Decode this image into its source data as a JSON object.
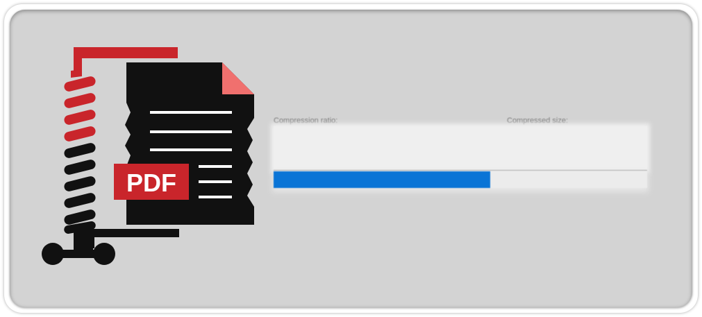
{
  "logo": {
    "text": "PDF",
    "icon": "pdf-compress-icon",
    "colors": {
      "red": "#c9252b",
      "black": "#111111",
      "corner": "#f0706e",
      "white": "#ffffff"
    }
  },
  "compression": {
    "ratio_label": "Compression ratio:",
    "size_label": "Compressed size:",
    "progress_fraction": 0.58,
    "progress_color": "#0a74d6"
  }
}
